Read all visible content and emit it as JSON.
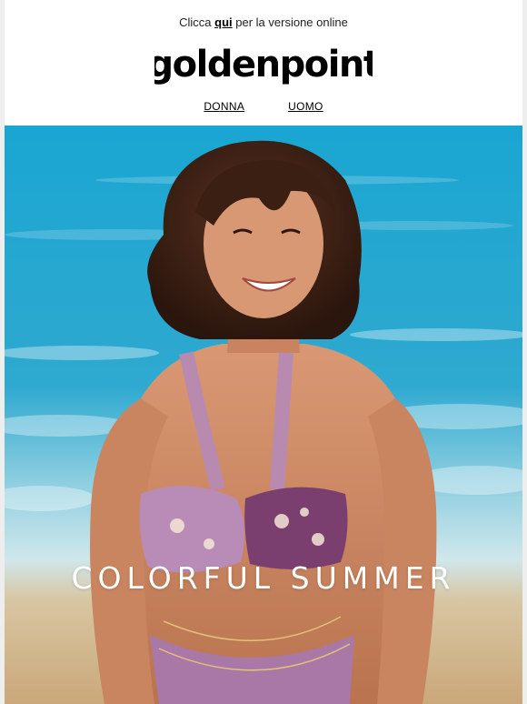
{
  "preheader": {
    "prefix": "Clicca ",
    "link": "qui",
    "suffix": " per la versione online"
  },
  "brand": {
    "name": "goldenpoint"
  },
  "nav": {
    "items": [
      {
        "label": "DONNA"
      },
      {
        "label": "UOMO"
      }
    ]
  },
  "hero": {
    "title": "COLORFUL SUMMER"
  },
  "colors": {
    "sea": "#2aa6cf",
    "sand": "#d9b98d",
    "text": "#000000"
  }
}
